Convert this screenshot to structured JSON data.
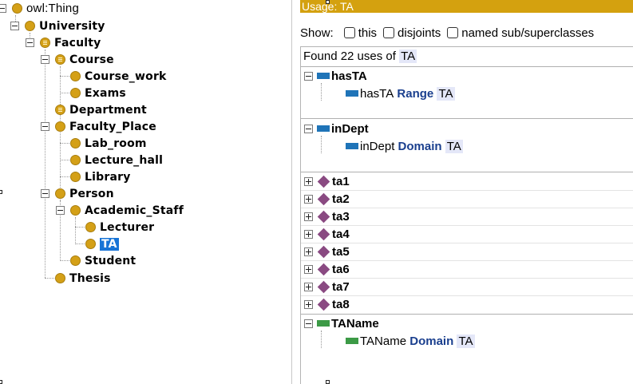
{
  "class_tree": {
    "root": "owl:Thing",
    "nodes": [
      {
        "id": "university",
        "label": "University"
      },
      {
        "id": "faculty",
        "label": "Faculty"
      },
      {
        "id": "course",
        "label": "Course"
      },
      {
        "id": "course-work",
        "label": "Course_work"
      },
      {
        "id": "exams",
        "label": "Exams"
      },
      {
        "id": "department",
        "label": "Department"
      },
      {
        "id": "faculty-place",
        "label": "Faculty_Place"
      },
      {
        "id": "lab-room",
        "label": "Lab_room"
      },
      {
        "id": "lecture-hall",
        "label": "Lecture_hall"
      },
      {
        "id": "library",
        "label": "Library"
      },
      {
        "id": "person",
        "label": "Person"
      },
      {
        "id": "academic-staff",
        "label": "Academic_Staff"
      },
      {
        "id": "lecturer",
        "label": "Lecturer"
      },
      {
        "id": "ta",
        "label": "TA",
        "selected": true
      },
      {
        "id": "student",
        "label": "Student"
      },
      {
        "id": "thesis",
        "label": "Thesis"
      }
    ]
  },
  "usage": {
    "header": "Usage: TA",
    "show_label": "Show:",
    "filters": [
      {
        "label": "this",
        "checked": false
      },
      {
        "label": "disjoints",
        "checked": false
      },
      {
        "label": "named sub/superclasses",
        "checked": false
      }
    ],
    "found_prefix": "Found 22 uses of",
    "entity": "TA",
    "groups": [
      {
        "name": "hasTA",
        "kind": "object-property",
        "detail_subject": "hasTA",
        "detail_keyword": "Range",
        "detail_object": "TA"
      },
      {
        "name": "inDept",
        "kind": "object-property",
        "detail_subject": "inDept",
        "detail_keyword": "Domain",
        "detail_object": "TA"
      }
    ],
    "individuals": [
      "ta1",
      "ta2",
      "ta3",
      "ta4",
      "ta5",
      "ta6",
      "ta7",
      "ta8"
    ],
    "data_group": {
      "name": "TAName",
      "kind": "data-property",
      "detail_subject": "TAName",
      "detail_keyword": "Domain",
      "detail_object": "TA"
    }
  },
  "colors": {
    "class_icon": "#d4a017",
    "header_bar": "#d4a10f",
    "selection": "#1874d6",
    "object_property": "#1f74b8",
    "data_property": "#3c9a46",
    "individual": "#8a4a82",
    "keyword": "#1a3f8e"
  }
}
